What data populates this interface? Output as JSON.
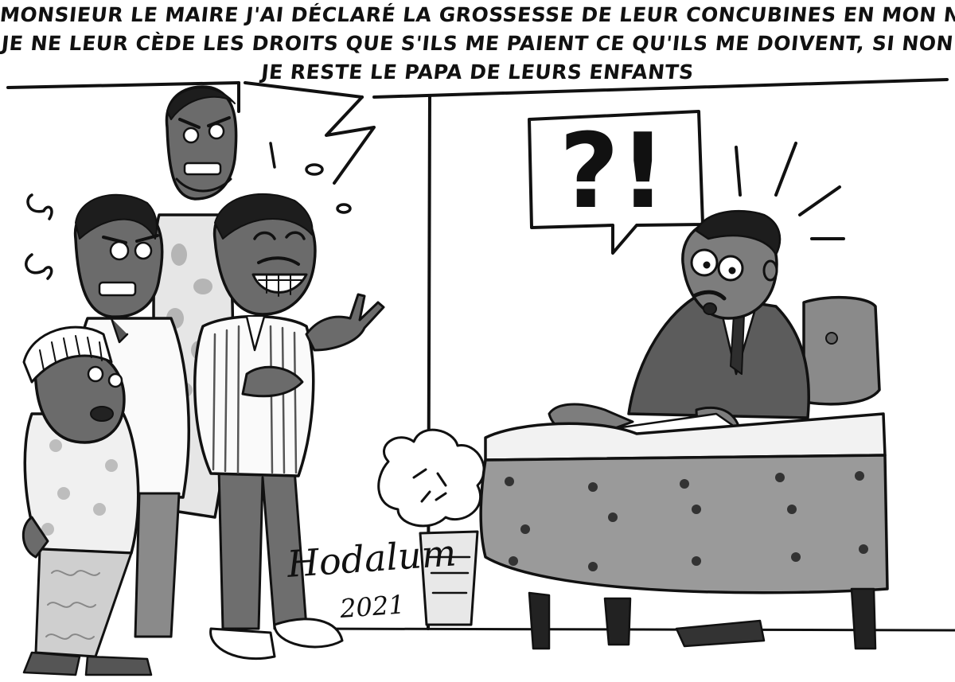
{
  "caption": {
    "line1": "Monsieur le maire j'ai déclaré la grossesse de leur concubines en mon nom.",
    "line2": "Je ne leur cède les droits que s'ils me paient ce qu'ils me doivent, si non",
    "line3": "je reste le papa de leurs enfants"
  },
  "mayor_bubble": {
    "text": "?!"
  },
  "signature": {
    "name": "Hodalum",
    "year": "2021"
  },
  "colors": {
    "ink": "#111111",
    "paper": "#ffffff",
    "wall": "#f4f4f4",
    "desk": "#9a9a9a",
    "skin": "#7d7d7d",
    "suit": "#5c5c5c"
  }
}
